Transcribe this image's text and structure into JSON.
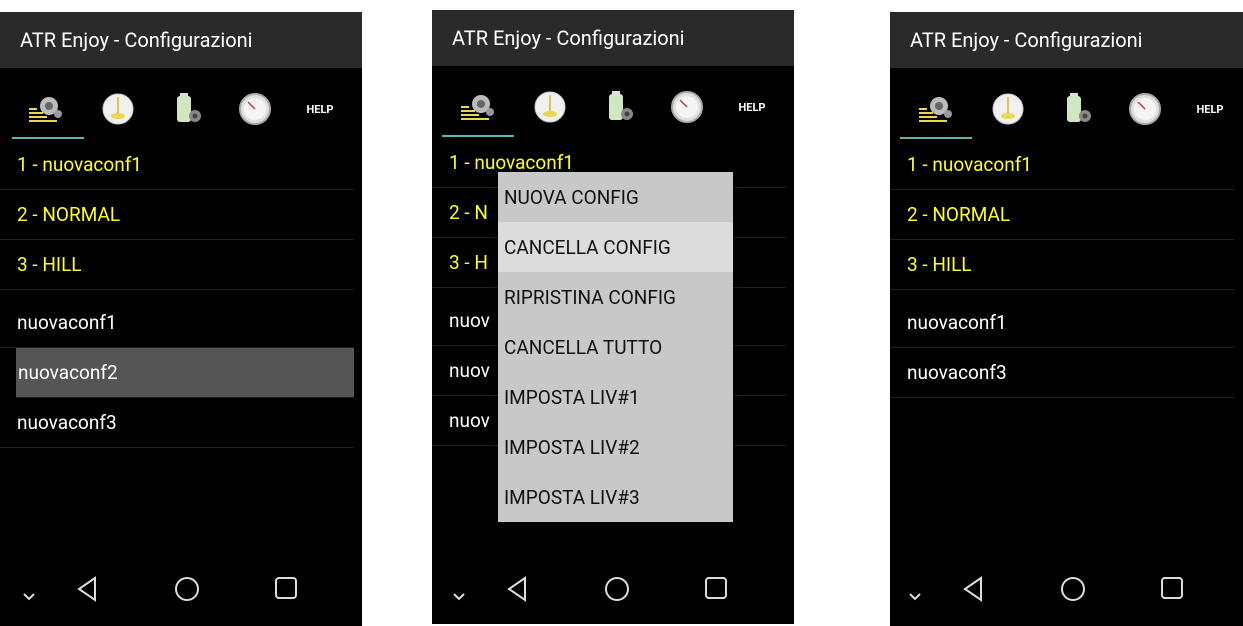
{
  "screen1": {
    "title": "ATR Enjoy - Configurazioni",
    "help_label": "HELP",
    "preset_rows": [
      "1 - nuovaconf1",
      "2 - NORMAL",
      "3 - HILL"
    ],
    "user_rows": [
      "nuovaconf1",
      "nuovaconf2",
      "nuovaconf3"
    ]
  },
  "screen2": {
    "title": "ATR Enjoy - Configurazioni",
    "help_label": "HELP",
    "preset_rows": [
      "1 - nuovaconf1",
      "2 - N",
      "3 - H"
    ],
    "user_rows": [
      "nuov",
      "nuov",
      "nuov"
    ],
    "menu_items": [
      "NUOVA CONFIG",
      "CANCELLA CONFIG",
      "RIPRISTINA CONFIG",
      "CANCELLA TUTTO",
      "IMPOSTA LIV#1",
      "IMPOSTA LIV#2",
      "IMPOSTA LIV#3"
    ]
  },
  "screen3": {
    "title": "ATR Enjoy - Configurazioni",
    "help_label": "HELP",
    "preset_rows": [
      "1 - nuovaconf1",
      "2 - NORMAL",
      "3 - HILL"
    ],
    "user_rows": [
      "nuovaconf1",
      "nuovaconf3"
    ]
  },
  "icons": {
    "tab1": "settings-list-icon",
    "tab2": "level-gauge-icon",
    "tab3": "battery-settings-icon",
    "tab4": "speedometer-icon",
    "nav_back": "back-triangle-icon",
    "nav_home": "home-circle-icon",
    "nav_recent": "recent-square-icon",
    "nav_down": "chevron-down-icon"
  },
  "colors": {
    "highlight_text": "#ffff1f",
    "tab_indicator": "#5fb3b3",
    "selected_row": "#555555",
    "menu_bg": "#c8c8c8",
    "menu_highlight": "#dcdcdc"
  }
}
